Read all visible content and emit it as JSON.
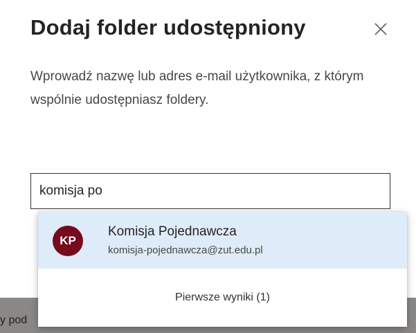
{
  "dialog": {
    "title": "Dodaj folder udostępniony",
    "close_icon": "close-icon",
    "description": "Wprowadź nazwę lub adres e-mail użytkownika, z którym wspólnie udostępniasz foldery."
  },
  "search": {
    "value": "komisja po"
  },
  "suggestions": {
    "items": [
      {
        "initials": "KP",
        "name": "Komisja Pojednawcza",
        "email": "komisja-pojednawcza@zut.edu.pl",
        "avatar_color": "#750b1c"
      }
    ],
    "footer_label": "Pierwsze wyniki (1)"
  },
  "background": {
    "partial_text": "y pod"
  },
  "colors": {
    "highlight": "#deecf9",
    "avatar": "#750b1c",
    "text_primary": "#252423"
  }
}
